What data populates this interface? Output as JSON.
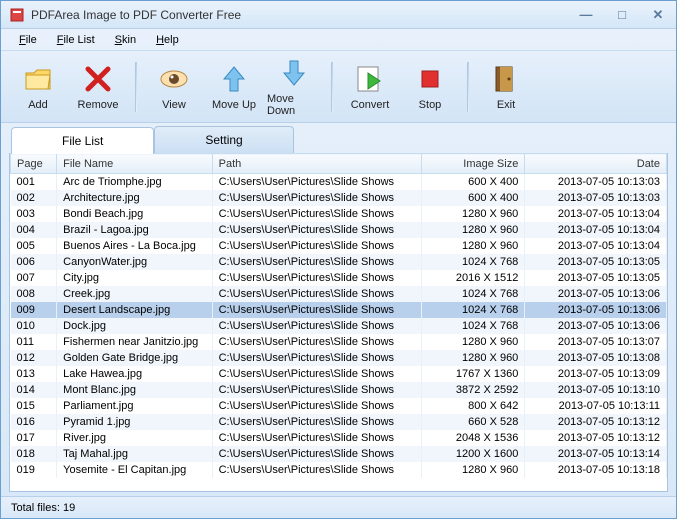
{
  "title": "PDFArea Image to PDF Converter Free",
  "menus": [
    "File",
    "File List",
    "Skin",
    "Help"
  ],
  "toolbar": [
    {
      "label": "Add",
      "icon": "folder"
    },
    {
      "label": "Remove",
      "icon": "x"
    },
    {
      "sep": true
    },
    {
      "label": "View",
      "icon": "eye"
    },
    {
      "label": "Move Up",
      "icon": "up"
    },
    {
      "label": "Move Down",
      "icon": "down"
    },
    {
      "sep": true
    },
    {
      "label": "Convert",
      "icon": "convert"
    },
    {
      "label": "Stop",
      "icon": "stop"
    },
    {
      "sep": true
    },
    {
      "label": "Exit",
      "icon": "door"
    }
  ],
  "tabs": [
    {
      "label": "File List",
      "active": true
    },
    {
      "label": "Setting",
      "active": false
    }
  ],
  "columns": [
    {
      "label": "Page",
      "align": "left"
    },
    {
      "label": "File Name",
      "align": "left"
    },
    {
      "label": "Path",
      "align": "left"
    },
    {
      "label": "Image Size",
      "align": "right"
    },
    {
      "label": "Date",
      "align": "right"
    }
  ],
  "defaultPath": "C:\\Users\\User\\Pictures\\Slide Shows",
  "selectedIndex": 8,
  "rows": [
    {
      "page": "001",
      "name": "Arc de Triomphe.jpg",
      "size": "600 X 400",
      "date": "2013-07-05 10:13:03"
    },
    {
      "page": "002",
      "name": "Architecture.jpg",
      "size": "600 X 400",
      "date": "2013-07-05 10:13:03"
    },
    {
      "page": "003",
      "name": "Bondi Beach.jpg",
      "size": "1280 X 960",
      "date": "2013-07-05 10:13:04"
    },
    {
      "page": "004",
      "name": "Brazil - Lagoa.jpg",
      "size": "1280 X 960",
      "date": "2013-07-05 10:13:04"
    },
    {
      "page": "005",
      "name": "Buenos Aires - La Boca.jpg",
      "size": "1280 X 960",
      "date": "2013-07-05 10:13:04"
    },
    {
      "page": "006",
      "name": "CanyonWater.jpg",
      "size": "1024 X 768",
      "date": "2013-07-05 10:13:05"
    },
    {
      "page": "007",
      "name": "City.jpg",
      "size": "2016 X 1512",
      "date": "2013-07-05 10:13:05"
    },
    {
      "page": "008",
      "name": "Creek.jpg",
      "size": "1024 X 768",
      "date": "2013-07-05 10:13:06"
    },
    {
      "page": "009",
      "name": "Desert Landscape.jpg",
      "size": "1024 X 768",
      "date": "2013-07-05 10:13:06"
    },
    {
      "page": "010",
      "name": "Dock.jpg",
      "size": "1024 X 768",
      "date": "2013-07-05 10:13:06"
    },
    {
      "page": "011",
      "name": "Fishermen near Janitzio.jpg",
      "size": "1280 X 960",
      "date": "2013-07-05 10:13:07"
    },
    {
      "page": "012",
      "name": "Golden Gate Bridge.jpg",
      "size": "1280 X 960",
      "date": "2013-07-05 10:13:08"
    },
    {
      "page": "013",
      "name": "Lake Hawea.jpg",
      "size": "1767 X 1360",
      "date": "2013-07-05 10:13:09"
    },
    {
      "page": "014",
      "name": "Mont Blanc.jpg",
      "size": "3872 X 2592",
      "date": "2013-07-05 10:13:10"
    },
    {
      "page": "015",
      "name": "Parliament.jpg",
      "size": "800 X 642",
      "date": "2013-07-05 10:13:11"
    },
    {
      "page": "016",
      "name": "Pyramid 1.jpg",
      "size": "660 X 528",
      "date": "2013-07-05 10:13:12"
    },
    {
      "page": "017",
      "name": "River.jpg",
      "size": "2048 X 1536",
      "date": "2013-07-05 10:13:12"
    },
    {
      "page": "018",
      "name": "Taj Mahal.jpg",
      "size": "1200 X 1600",
      "date": "2013-07-05 10:13:14"
    },
    {
      "page": "019",
      "name": "Yosemite - El Capitan.jpg",
      "size": "1280 X 960",
      "date": "2013-07-05 10:13:18"
    }
  ],
  "status": "Total files: 19"
}
